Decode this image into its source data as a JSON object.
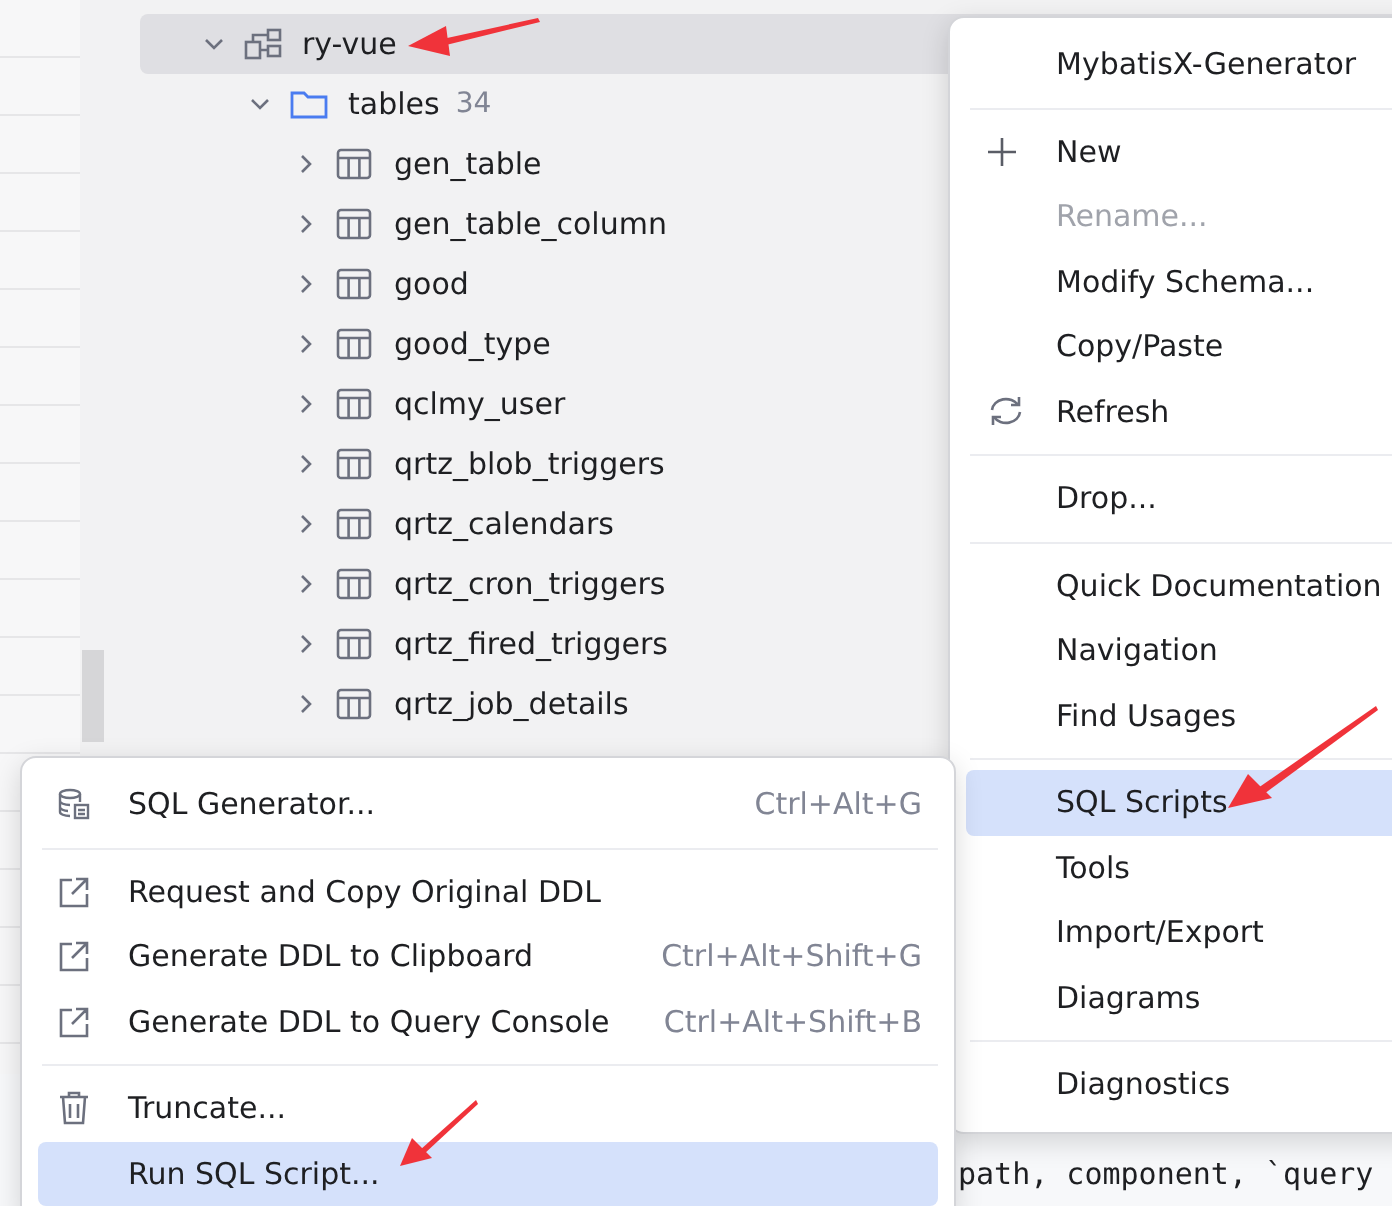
{
  "tree": [
    {
      "label": "ry-vue",
      "kind": "schema",
      "expanded": true,
      "selected": true,
      "children": [
        {
          "label": "tables",
          "count": "34",
          "kind": "folder",
          "expanded": true,
          "selected": false,
          "children": [
            {
              "label": "gen_table",
              "kind": "table",
              "expanded": false,
              "selected": false
            },
            {
              "label": "gen_table_column",
              "kind": "table",
              "expanded": false,
              "selected": false
            },
            {
              "label": "good",
              "kind": "table",
              "expanded": false,
              "selected": false
            },
            {
              "label": "good_type",
              "kind": "table",
              "expanded": false,
              "selected": false
            },
            {
              "label": "qclmy_user",
              "kind": "table",
              "expanded": false,
              "selected": false
            },
            {
              "label": "qrtz_blob_triggers",
              "kind": "table",
              "expanded": false,
              "selected": false
            },
            {
              "label": "qrtz_calendars",
              "kind": "table",
              "expanded": false,
              "selected": false
            },
            {
              "label": "qrtz_cron_triggers",
              "kind": "table",
              "expanded": false,
              "selected": false
            },
            {
              "label": "qrtz_fired_triggers",
              "kind": "table",
              "expanded": false,
              "selected": false
            },
            {
              "label": "qrtz_job_details",
              "kind": "table",
              "expanded": false,
              "selected": false
            }
          ]
        }
      ]
    }
  ],
  "code": {
    "line_2_end": "path, component, `query"
  },
  "context_menu": [
    {
      "kind": "item",
      "label": "MybatisX-Generator",
      "selected": false,
      "disabled": false
    },
    {
      "kind": "separator"
    },
    {
      "kind": "item",
      "label": "New",
      "selected": false,
      "disabled": false
    },
    {
      "kind": "item",
      "label": "Rename...",
      "selected": false,
      "disabled": true
    },
    {
      "kind": "item",
      "label": "Modify Schema...",
      "selected": false,
      "disabled": false
    },
    {
      "kind": "item",
      "label": "Copy/Paste",
      "selected": false,
      "disabled": false
    },
    {
      "kind": "item",
      "label": "Refresh",
      "selected": false,
      "disabled": false
    },
    {
      "kind": "separator"
    },
    {
      "kind": "item",
      "label": "Drop...",
      "selected": false,
      "disabled": false
    },
    {
      "kind": "separator"
    },
    {
      "kind": "item",
      "label": "Quick Documentation",
      "selected": false,
      "disabled": false
    },
    {
      "kind": "item",
      "label": "Navigation",
      "selected": false,
      "disabled": false
    },
    {
      "kind": "item",
      "label": "Find Usages",
      "selected": false,
      "disabled": false
    },
    {
      "kind": "separator"
    },
    {
      "kind": "item",
      "label": "SQL Scripts",
      "selected": true,
      "disabled": false
    },
    {
      "kind": "item",
      "label": "Tools",
      "selected": false,
      "disabled": false
    },
    {
      "kind": "item",
      "label": "Import/Export",
      "selected": false,
      "disabled": false
    },
    {
      "kind": "item",
      "label": "Diagrams",
      "selected": false,
      "disabled": false
    },
    {
      "kind": "separator"
    },
    {
      "kind": "item",
      "label": "Diagnostics",
      "selected": false,
      "disabled": false
    }
  ],
  "submenu": [
    {
      "kind": "item",
      "label": "SQL Generator...",
      "shortcut": "Ctrl+Alt+G",
      "selected": false,
      "disabled": false
    },
    {
      "kind": "separator"
    },
    {
      "kind": "item",
      "label": "Request and Copy Original DDL",
      "selected": false,
      "disabled": false
    },
    {
      "kind": "item",
      "label": "Generate DDL to Clipboard",
      "shortcut": "Ctrl+Alt+Shift+G",
      "selected": false,
      "disabled": false
    },
    {
      "kind": "item",
      "label": "Generate DDL to Query Console",
      "shortcut": "Ctrl+Alt+Shift+B",
      "selected": false,
      "disabled": false
    },
    {
      "kind": "separator"
    },
    {
      "kind": "item",
      "label": "Truncate...",
      "selected": false,
      "disabled": false
    },
    {
      "kind": "item",
      "label": "Run SQL Script...",
      "selected": true,
      "disabled": false
    }
  ]
}
